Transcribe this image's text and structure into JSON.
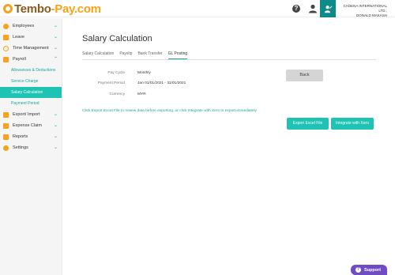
{
  "brand": {
    "part1": "Tembo",
    "part2": "-Pay.com"
  },
  "header": {
    "help_glyph": "?",
    "company_line1": "CADENA INTERNATIONAL LTD.,",
    "company_line2": "DONALD MAKASH"
  },
  "sidebar": {
    "items": [
      {
        "label": "Employees",
        "icon": "employees-icon",
        "color": "#f7a21b"
      },
      {
        "label": "Leave",
        "icon": "leave-icon",
        "color": "#f7a21b"
      },
      {
        "label": "Time Management",
        "icon": "time-icon",
        "color": "#f7a21b"
      },
      {
        "label": "Payroll",
        "icon": "payroll-icon",
        "color": "#f7a21b"
      }
    ],
    "payroll_sub": [
      {
        "label": "Allowances & Deductions"
      },
      {
        "label": "Service Charge"
      },
      {
        "label": "Salary Calculation"
      },
      {
        "label": "Payment Period"
      }
    ],
    "items2": [
      {
        "label": "Export/ Import",
        "icon": "export-icon"
      },
      {
        "label": "Expense Claim",
        "icon": "expense-icon"
      },
      {
        "label": "Reports",
        "icon": "reports-icon"
      },
      {
        "label": "Settings",
        "icon": "settings-icon"
      }
    ]
  },
  "main": {
    "title": "Salary Calculation",
    "tabs": [
      "Salary Calculation",
      "Payslip",
      "Bank Transfer",
      "GL Posting"
    ],
    "active_tab": "GL Posting",
    "fields": [
      {
        "label": "Pay Cycle",
        "value": "Monthly"
      },
      {
        "label": "Payment Period",
        "value": "Jan 01/01/2021 - 31/01/2021"
      },
      {
        "label": "Currency",
        "value": "MYR"
      }
    ],
    "back_label": "Back",
    "info_text": "Click Export Excel File to review data before exporting, or click Integrate with Xero to export immediately",
    "export_label": "Export Excel File",
    "xero_label": "Integrate with Xero"
  },
  "support_label": "Support",
  "colors": {
    "accent": "#1ec3b4",
    "accent_dark": "#0e8a8a",
    "brand_orange": "#f7a21b",
    "support": "#6f4cc3"
  }
}
